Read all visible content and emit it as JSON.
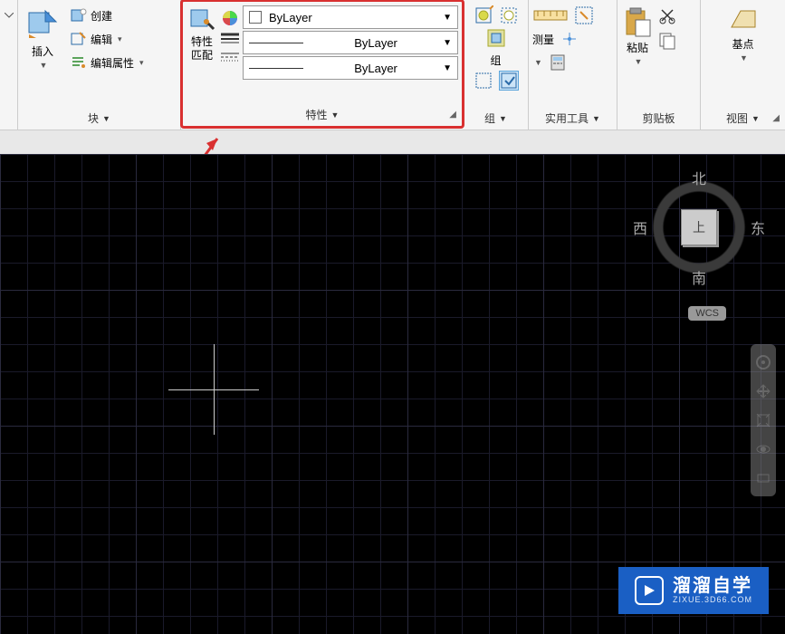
{
  "ribbon": {
    "block": {
      "insert": "插入",
      "create": "创建",
      "edit": "编辑",
      "edit_attr": "编辑属性",
      "panel_label": "块"
    },
    "properties": {
      "match_props_line1": "特性",
      "match_props_line2": "匹配",
      "color_combo": "ByLayer",
      "lineweight_combo": "ByLayer",
      "linetype_combo": "ByLayer",
      "panel_label": "特性"
    },
    "group": {
      "group_label": "组",
      "panel_label": "组"
    },
    "utility": {
      "measure": "测量",
      "panel_label": "实用工具"
    },
    "clipboard": {
      "paste": "粘贴",
      "panel_label": "剪贴板"
    },
    "view": {
      "base": "基点",
      "panel_label": "视图"
    }
  },
  "viewcube": {
    "north": "北",
    "south": "南",
    "east": "东",
    "west": "西",
    "top": "上"
  },
  "wcs": "WCS",
  "watermark": {
    "title": "溜溜自学",
    "url": "ZIXUE.3D66.COM"
  }
}
